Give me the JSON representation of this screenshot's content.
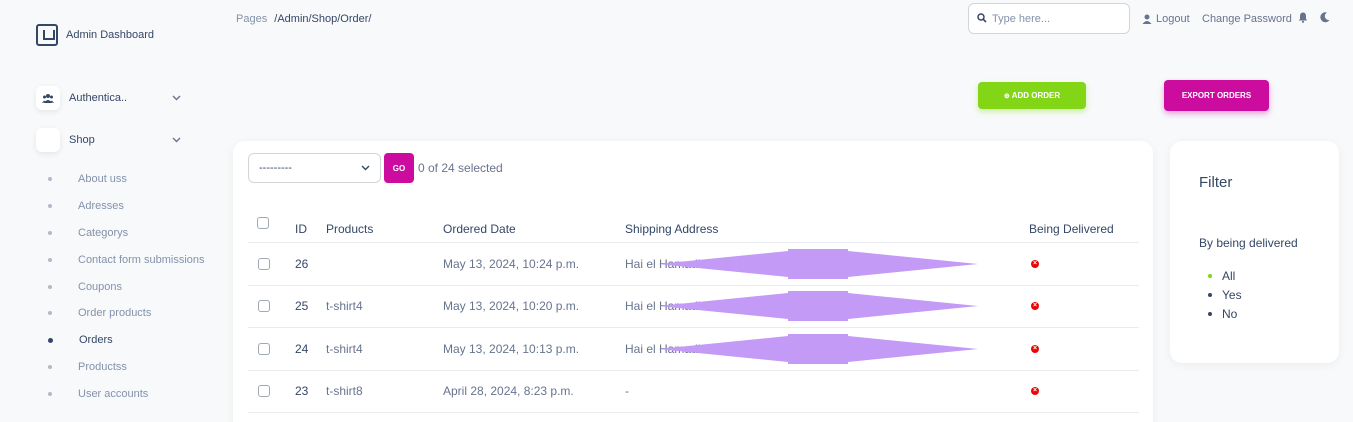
{
  "brand": {
    "title": "Admin Dashboard"
  },
  "sidebar": {
    "groups": [
      {
        "label": "Authentica..",
        "icon": "users-icon"
      },
      {
        "label": "Shop",
        "icon": "shop-icon"
      }
    ],
    "items": [
      {
        "label": "About uss",
        "active": false
      },
      {
        "label": "Adresses",
        "active": false
      },
      {
        "label": "Categorys",
        "active": false
      },
      {
        "label": "Contact form submissions",
        "active": false
      },
      {
        "label": "Coupons",
        "active": false
      },
      {
        "label": "Order products",
        "active": false
      },
      {
        "label": "Orders",
        "active": true
      },
      {
        "label": "Productss",
        "active": false
      },
      {
        "label": "User accounts",
        "active": false
      }
    ]
  },
  "topbar": {
    "breadcrumb_root": "Pages",
    "breadcrumb_path": "/Admin/Shop/Order/",
    "search_placeholder": "Type here...",
    "logout": "Logout",
    "change_password": "Change Password"
  },
  "actions": {
    "add_order": "ADD ORDER",
    "export_orders": "EXPORT ORDERS"
  },
  "toolbar": {
    "action_select": "---------",
    "go": "GO",
    "selected_count": "0 of 24 selected"
  },
  "table": {
    "columns": [
      "ID",
      "Products",
      "Ordered Date",
      "Shipping Address",
      "Being Delivered"
    ],
    "rows": [
      {
        "id": "26",
        "product": "",
        "date": "May 13, 2024, 10:24 p.m.",
        "address": "Hai el Hamadia N... ...ay, DZ, 02000",
        "redacted": true
      },
      {
        "id": "25",
        "product": "t-shirt4",
        "date": "May 13, 2024, 10:20 p.m.",
        "address": "Hai el Hamadia N... ..., DZ, 02000",
        "redacted": true
      },
      {
        "id": "24",
        "product": "t-shirt4",
        "date": "May 13, 2024, 10:13 p.m.",
        "address": "Hai el Hamadia N... ..., DZ, 02000",
        "redacted": true
      },
      {
        "id": "23",
        "product": "t-shirt8",
        "date": "April 28, 2024, 8:23 p.m.",
        "address": "-",
        "redacted": false
      }
    ]
  },
  "filter": {
    "title": "Filter",
    "subtitle": "By being delivered",
    "options": [
      {
        "label": "All",
        "selected": true
      },
      {
        "label": "Yes",
        "selected": false
      },
      {
        "label": "No",
        "selected": false
      }
    ]
  },
  "colors": {
    "primary": "#cb0c9f",
    "success": "#82d616",
    "danger": "#ea0606",
    "redaction": "#c39af5"
  }
}
